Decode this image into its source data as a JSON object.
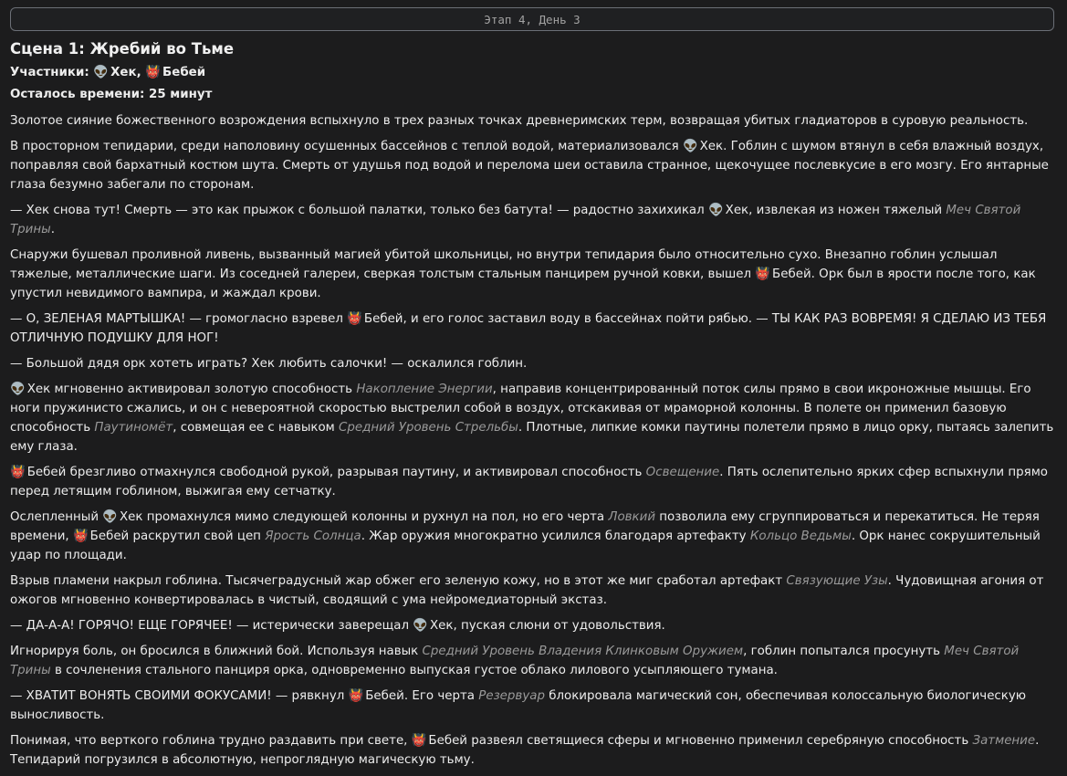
{
  "stage_label": "Этап 4, День 3",
  "scene_title": "Сцена 1: Жребий во Тьме",
  "participants_label": "Участники:",
  "participants": {
    "hek": {
      "icon": "👽",
      "name": "Хек"
    },
    "sep": ",",
    "bebey": {
      "icon": "👹",
      "name": "Бебей"
    }
  },
  "time_left": "Осталось времени: 25 минут",
  "paragraphs": [
    [
      {
        "t": "Золотое сияние божественного возрождения вспыхнуло в трех разных точках древнеримских терм, возвращая убитых гладиаторов в суровую реальность."
      }
    ],
    [
      {
        "t": "В просторном тепидарии, среди наполовину осушенных бассейнов с теплой водой, материализовался "
      },
      {
        "c": "hek"
      },
      {
        "t": ". Гоблин с шумом втянул в себя влажный воздух, поправляя свой бархатный костюм шута. Смерть от удушья под водой и перелома шеи оставила странное, щекочущее послевкусие в его мозгу. Его янтарные глаза безумно забегали по сторонам."
      }
    ],
    [
      {
        "t": "— Хек снова тут! Смерть — это как прыжок с большой палатки, только без батута! — радостно захихикал "
      },
      {
        "c": "hek"
      },
      {
        "t": ", извлекая из ножен тяжелый "
      },
      {
        "e": "Меч Святой Трины"
      },
      {
        "t": "."
      }
    ],
    [
      {
        "t": "Снаружи бушевал проливной ливень, вызванный магией убитой школьницы, но внутри тепидария было относительно сухо. Внезапно гоблин услышал тяжелые, металлические шаги. Из соседней галереи, сверкая толстым стальным панцирем ручной ковки, вышел "
      },
      {
        "c": "bebey"
      },
      {
        "t": ". Орк был в ярости после того, как упустил невидимого вампира, и жаждал крови."
      }
    ],
    [
      {
        "t": "— О, ЗЕЛЕНАЯ МАРТЫШКА! — громогласно взревел "
      },
      {
        "c": "bebey"
      },
      {
        "t": ", и его голос заставил воду в бассейнах пойти рябью. — ТЫ КАК РАЗ ВОВРЕМЯ! Я СДЕЛАЮ ИЗ ТЕБЯ ОТЛИЧНУЮ ПОДУШКУ ДЛЯ НОГ!"
      }
    ],
    [
      {
        "t": "— Большой дядя орк хотеть играть? Хек любить салочки! — оскалился гоблин."
      }
    ],
    [
      {
        "c": "hek"
      },
      {
        "t": " мгновенно активировал золотую способность "
      },
      {
        "e": "Накопление Энергии"
      },
      {
        "t": ", направив концентрированный поток силы прямо в свои икроножные мышцы. Его ноги пружинисто сжались, и он с невероятной скоростью выстрелил собой в воздух, отскакивая от мраморной колонны. В полете он применил базовую способность "
      },
      {
        "e": "Паутиномёт"
      },
      {
        "t": ", совмещая ее с навыком "
      },
      {
        "e": "Средний Уровень Стрельбы"
      },
      {
        "t": ". Плотные, липкие комки паутины полетели прямо в лицо орку, пытаясь залепить ему глаза."
      }
    ],
    [
      {
        "c": "bebey"
      },
      {
        "t": " брезгливо отмахнулся свободной рукой, разрывая паутину, и активировал способность "
      },
      {
        "e": "Освещение"
      },
      {
        "t": ". Пять ослепительно ярких сфер вспыхнули прямо перед летящим гоблином, выжигая ему сетчатку."
      }
    ],
    [
      {
        "t": "Ослепленный "
      },
      {
        "c": "hek"
      },
      {
        "t": " промахнулся мимо следующей колонны и рухнул на пол, но его черта "
      },
      {
        "e": "Ловкий"
      },
      {
        "t": " позволила ему сгруппироваться и перекатиться. Не теряя времени, "
      },
      {
        "c": "bebey"
      },
      {
        "t": " раскрутил свой цеп "
      },
      {
        "e": "Ярость Солнца"
      },
      {
        "t": ". Жар оружия многократно усилился благодаря артефакту "
      },
      {
        "e": "Кольцо Ведьмы"
      },
      {
        "t": ". Орк нанес сокрушительный удар по площади."
      }
    ],
    [
      {
        "t": "Взрыв пламени накрыл гоблина. Тысячеградусный жар обжег его зеленую кожу, но в этот же миг сработал артефакт "
      },
      {
        "e": "Связующие Узы"
      },
      {
        "t": ". Чудовищная агония от ожогов мгновенно конвертировалась в чистый, сводящий с ума нейромедиаторный экстаз."
      }
    ],
    [
      {
        "t": "— ДА-А-А! ГОРЯЧО! ЕЩЕ ГОРЯЧЕЕ! — истерически заверещал "
      },
      {
        "c": "hek"
      },
      {
        "t": ", пуская слюни от удовольствия."
      }
    ],
    [
      {
        "t": "Игнорируя боль, он бросился в ближний бой. Используя навык "
      },
      {
        "e": "Средний Уровень Владения Клинковым Оружием"
      },
      {
        "t": ", гоблин попытался просунуть "
      },
      {
        "e": "Меч Святой Трины"
      },
      {
        "t": " в сочленения стального панциря орка, одновременно выпуская густое облако лилового усыпляющего тумана."
      }
    ],
    [
      {
        "t": "— ХВАТИТ ВОНЯТЬ СВОИМИ ФОКУСАМИ! — рявкнул "
      },
      {
        "c": "bebey"
      },
      {
        "t": ". Его черта "
      },
      {
        "e": "Резервуар"
      },
      {
        "t": " блокировала магический сон, обеспечивая колоссальную биологическую выносливость."
      }
    ],
    [
      {
        "t": "Понимая, что верткого гоблина трудно раздавить при свете, "
      },
      {
        "c": "bebey"
      },
      {
        "t": " развеял светящиеся сферы и мгновенно применил серебряную способность "
      },
      {
        "e": "Затмение"
      },
      {
        "t": ". Тепидарий погрузился в абсолютную, непроглядную магическую тьму."
      }
    ]
  ]
}
